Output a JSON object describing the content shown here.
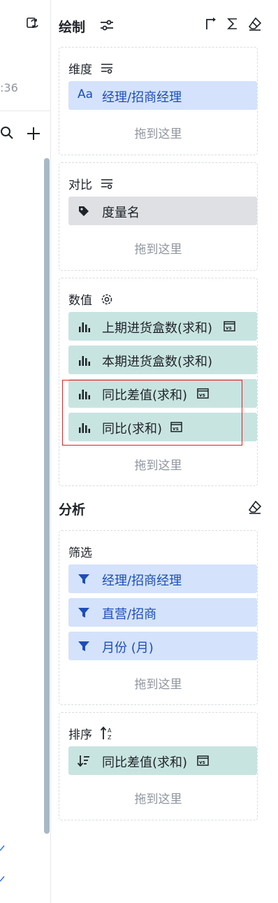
{
  "left_strip": {
    "time_fragment": ":36"
  },
  "draw": {
    "title": "绘制",
    "dimension": {
      "label": "维度",
      "items": [
        {
          "text": "经理/招商经理",
          "icon": "text-type-icon"
        }
      ],
      "drop_hint": "拖到这里"
    },
    "compare": {
      "label": "对比",
      "items": [
        {
          "text": "度量名",
          "icon": "tag-icon"
        }
      ],
      "drop_hint": "拖到这里"
    },
    "values": {
      "label": "数值",
      "items": [
        {
          "text": "上期进货盒数(求和)",
          "icon": "bar-chart-icon",
          "vs": true
        },
        {
          "text": "本期进货盒数(求和)",
          "icon": "bar-chart-icon",
          "vs": false
        },
        {
          "text": "同比差值(求和)",
          "icon": "bar-chart-icon",
          "vs": true
        },
        {
          "text": "同比(求和)",
          "icon": "bar-chart-icon",
          "vs": true
        }
      ],
      "drop_hint": "拖到这里"
    }
  },
  "analysis": {
    "title": "分析",
    "filter": {
      "label": "筛选",
      "items": [
        {
          "text": "经理/招商经理",
          "icon": "filter-icon"
        },
        {
          "text": "直营/招商",
          "icon": "filter-icon"
        },
        {
          "text": "月份 (月)",
          "icon": "filter-icon"
        }
      ],
      "drop_hint": "拖到这里"
    },
    "sort": {
      "label": "排序",
      "items": [
        {
          "text": "同比差值(求和)",
          "icon": "sort-desc-icon",
          "vs": true
        }
      ],
      "drop_hint": "拖到这里"
    }
  },
  "colors": {
    "blue_pill": "#d4e2fb",
    "teal_pill": "#c8e4e1",
    "gray_pill": "#dee0e3",
    "highlight": "#e02020"
  }
}
